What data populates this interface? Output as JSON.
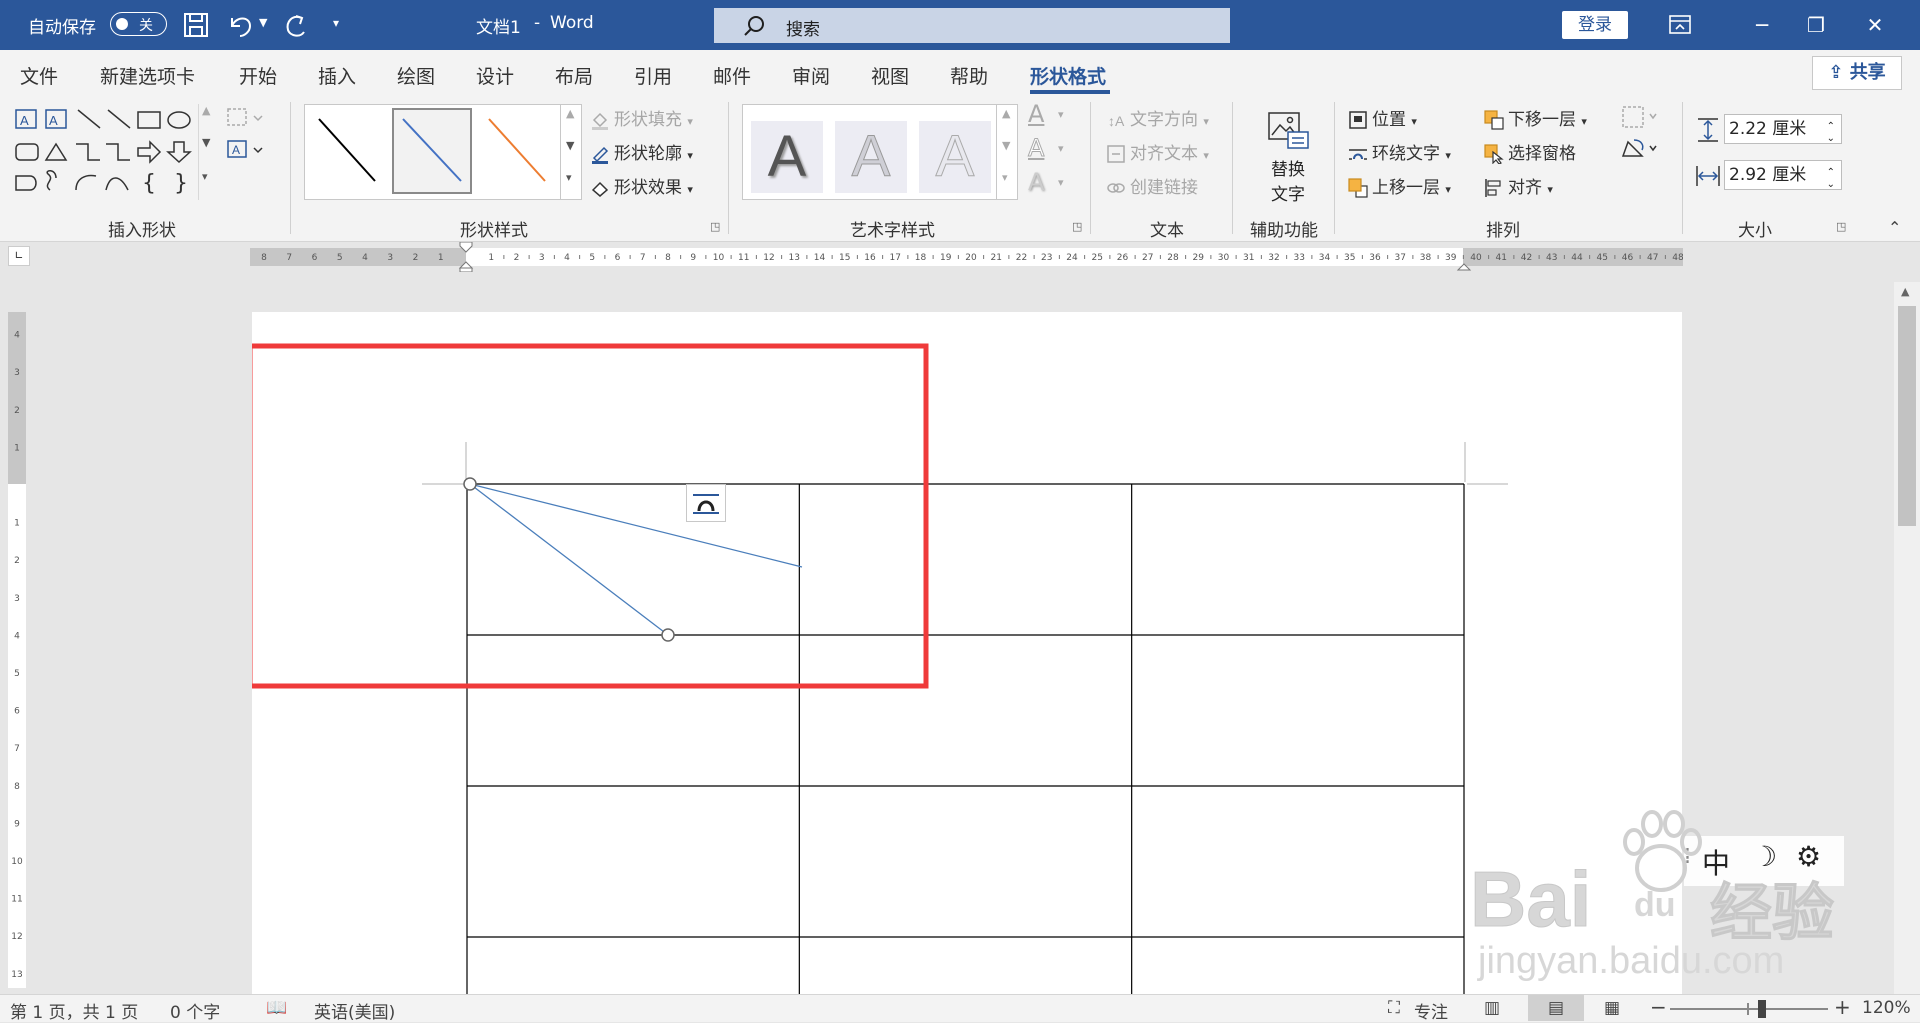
{
  "titlebar": {
    "autosave_label": "自动保存",
    "autosave_state": "关",
    "doc_title": "文档1",
    "separator": "-",
    "app_name": "Word",
    "search_placeholder": "搜索",
    "login_label": "登录",
    "minimize": "─",
    "restore": "❐",
    "close": "✕"
  },
  "tabs": [
    {
      "label": "文件"
    },
    {
      "label": "新建选项卡"
    },
    {
      "label": "开始"
    },
    {
      "label": "插入"
    },
    {
      "label": "绘图"
    },
    {
      "label": "设计"
    },
    {
      "label": "布局"
    },
    {
      "label": "引用"
    },
    {
      "label": "邮件"
    },
    {
      "label": "审阅"
    },
    {
      "label": "视图"
    },
    {
      "label": "帮助"
    },
    {
      "label": "形状格式"
    }
  ],
  "active_tab": "形状格式",
  "share_label": "共享",
  "ribbon": {
    "insert_shapes": {
      "label": "插入形状"
    },
    "shape_styles": {
      "label": "形状样式",
      "fill": "形状填充",
      "outline": "形状轮廓",
      "effects": "形状效果"
    },
    "wordart": {
      "label": "艺术字样式",
      "letter": "A"
    },
    "text": {
      "label": "文本",
      "direction": "文字方向",
      "align": "对齐文本",
      "link": "创建链接"
    },
    "accessibility": {
      "label": "辅助功能",
      "alt_text_1": "替换",
      "alt_text_2": "文字"
    },
    "arrange": {
      "label": "排列",
      "position": "位置",
      "wrap": "环绕文字",
      "bring_forward": "上移一层",
      "send_backward": "下移一层",
      "selection_pane": "选择窗格",
      "align": "对齐"
    },
    "size": {
      "label": "大小",
      "height": "2.22 厘米",
      "width": "2.92 厘米"
    }
  },
  "ruler": {
    "h_left": [
      "8",
      "7",
      "6",
      "5",
      "4",
      "3",
      "2",
      "1"
    ],
    "h_right": [
      "1",
      "2",
      "3",
      "4",
      "5",
      "6",
      "7",
      "8",
      "9",
      "10",
      "11",
      "12",
      "13",
      "14",
      "15",
      "16",
      "17",
      "18",
      "19",
      "20",
      "21",
      "22",
      "23",
      "24",
      "25",
      "26",
      "27",
      "28",
      "29",
      "30",
      "31",
      "32",
      "33",
      "34",
      "35",
      "36",
      "37",
      "38",
      "39",
      "40",
      "41",
      "42",
      "43",
      "44",
      "45",
      "46",
      "47",
      "48"
    ],
    "v_top": [
      "4",
      "3",
      "2",
      "1"
    ],
    "v_bottom": [
      "1",
      "2",
      "3",
      "4",
      "5",
      "6",
      "7",
      "8",
      "9",
      "10",
      "11",
      "12",
      "13"
    ]
  },
  "table": {
    "rows": 4,
    "cols": 3
  },
  "colors": {
    "accent": "#2b579a",
    "highlight": "#ef3a3a",
    "shape_line": "#4a7ebb"
  },
  "status": {
    "page": "第 1 页，共 1 页",
    "words": "0 个字",
    "language": "英语(美国)",
    "focus": "专注",
    "zoom": "120%"
  },
  "ime": {
    "mode": "中",
    "moon": "☽",
    "gear": "⚙"
  },
  "watermark": {
    "brand": "Bai",
    "brand2": "du",
    "cn": "经验",
    "url": "jingyan.baidu.com"
  }
}
